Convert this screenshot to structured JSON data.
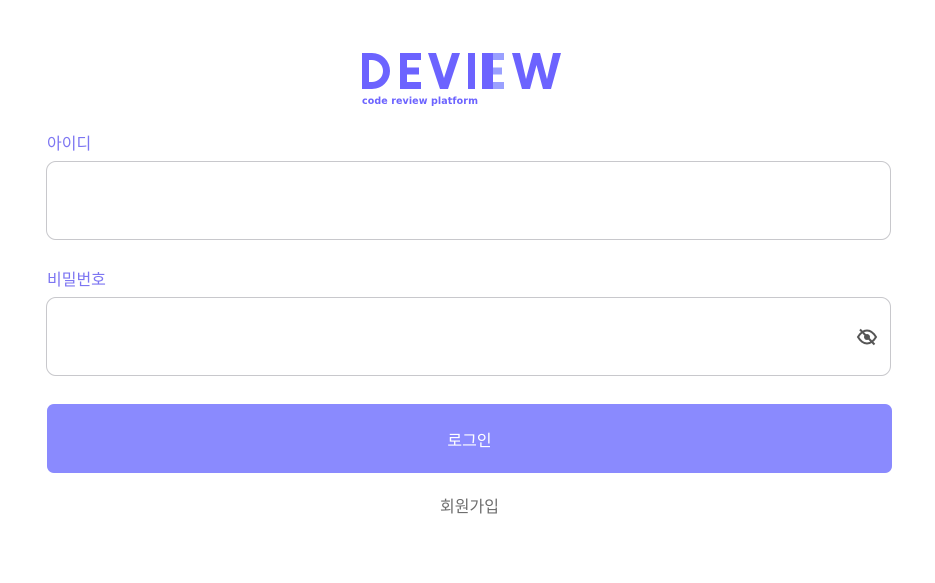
{
  "brand": {
    "name": "DEVIEW",
    "tagline": "code review platform",
    "primary_color": "#6c63ff",
    "secondary_color": "#9aa0ff"
  },
  "form": {
    "id_label": "아이디",
    "id_value": "",
    "password_label": "비밀번호",
    "password_value": "",
    "toggle_icon": "eye-off-icon",
    "login_label": "로그인",
    "login_color": "#8a8afe",
    "signup_label": "회원가입"
  }
}
